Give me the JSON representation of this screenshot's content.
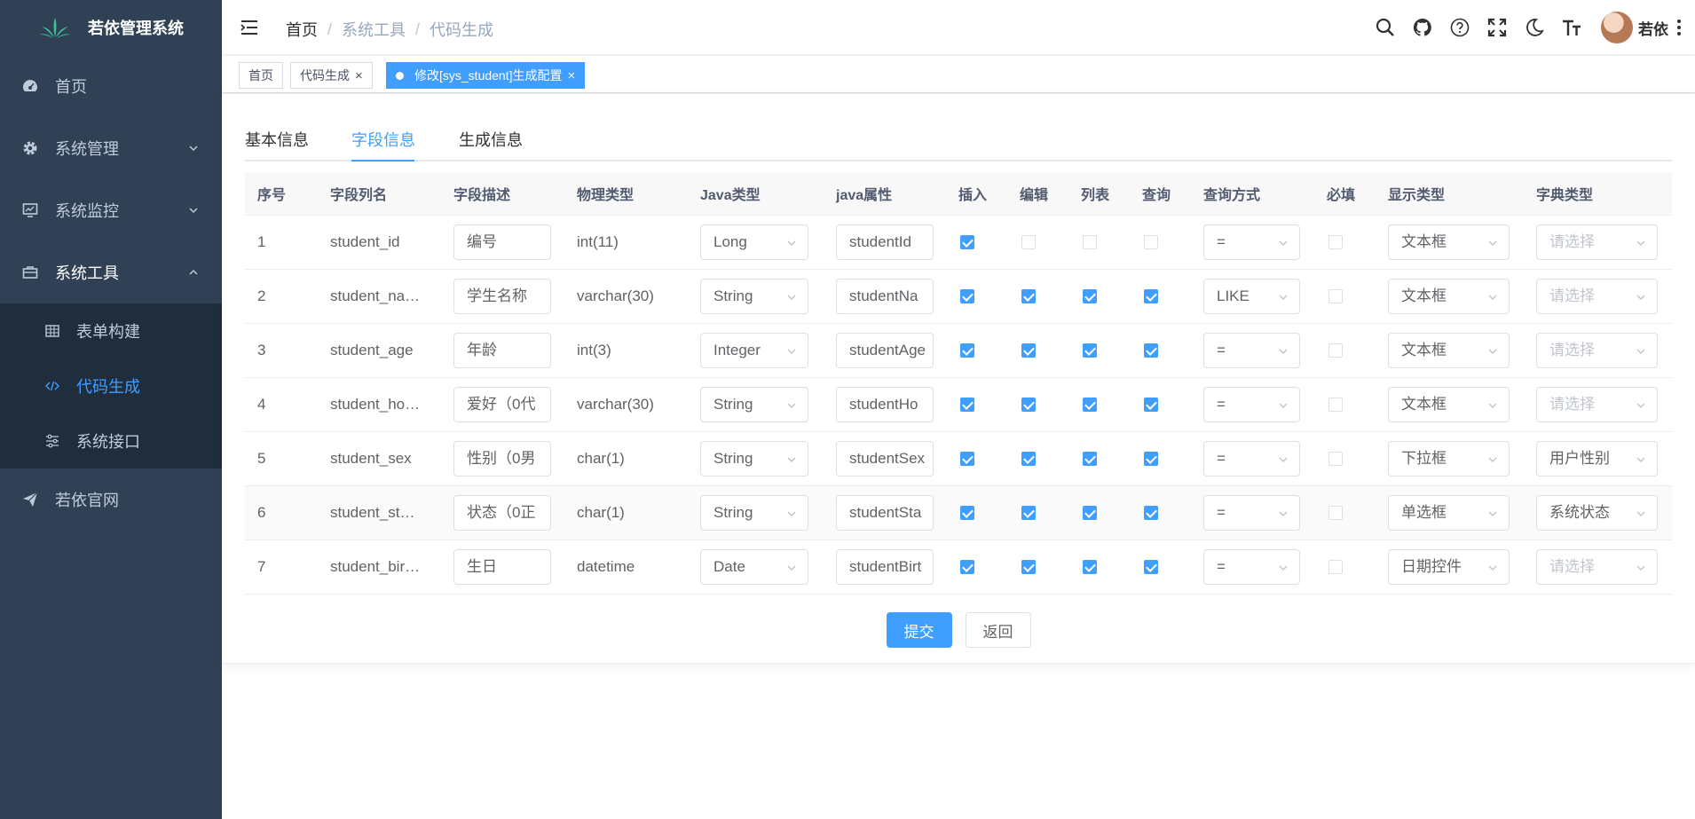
{
  "app": {
    "title": "若依管理系统"
  },
  "sidebar": {
    "items": [
      {
        "label": "首页",
        "icon": "dashboard-icon"
      },
      {
        "label": "系统管理",
        "icon": "gear-icon"
      },
      {
        "label": "系统监控",
        "icon": "monitor-icon"
      },
      {
        "label": "系统工具",
        "icon": "toolbox-icon"
      },
      {
        "label": "若依官网",
        "icon": "send-icon"
      }
    ],
    "tool_sub": [
      {
        "label": "表单构建",
        "icon": "table-icon"
      },
      {
        "label": "代码生成",
        "icon": "code-icon"
      },
      {
        "label": "系统接口",
        "icon": "sliders-icon"
      }
    ]
  },
  "navbar": {
    "breadcrumb": [
      "首页",
      "系统工具",
      "代码生成"
    ],
    "user": "若依"
  },
  "tags": [
    {
      "label": "首页"
    },
    {
      "label": "代码生成"
    },
    {
      "label": "修改[sys_student]生成配置"
    }
  ],
  "tabs": [
    "基本信息",
    "字段信息",
    "生成信息"
  ],
  "table": {
    "headers": [
      "序号",
      "字段列名",
      "字段描述",
      "物理类型",
      "Java类型",
      "java属性",
      "插入",
      "编辑",
      "列表",
      "查询",
      "查询方式",
      "必填",
      "显示类型",
      "字典类型"
    ],
    "rows": [
      {
        "no": "1",
        "column": "student_id",
        "desc": "编号",
        "phys": "int(11)",
        "jtype": "Long",
        "jprop": "studentId",
        "insert": true,
        "edit": false,
        "list": false,
        "query": false,
        "qmode": "=",
        "required": false,
        "display": "文本框",
        "dict": "请选择"
      },
      {
        "no": "2",
        "column": "student_na…",
        "desc": "学生名称",
        "phys": "varchar(30)",
        "jtype": "String",
        "jprop": "studentNa",
        "insert": true,
        "edit": true,
        "list": true,
        "query": true,
        "qmode": "LIKE",
        "required": false,
        "display": "文本框",
        "dict": "请选择"
      },
      {
        "no": "3",
        "column": "student_age",
        "desc": "年龄",
        "phys": "int(3)",
        "jtype": "Integer",
        "jprop": "studentAge",
        "insert": true,
        "edit": true,
        "list": true,
        "query": true,
        "qmode": "=",
        "required": false,
        "display": "文本框",
        "dict": "请选择"
      },
      {
        "no": "4",
        "column": "student_ho…",
        "desc": "爱好（0代",
        "phys": "varchar(30)",
        "jtype": "String",
        "jprop": "studentHo",
        "insert": true,
        "edit": true,
        "list": true,
        "query": true,
        "qmode": "=",
        "required": false,
        "display": "文本框",
        "dict": "请选择"
      },
      {
        "no": "5",
        "column": "student_sex",
        "desc": "性别（0男",
        "phys": "char(1)",
        "jtype": "String",
        "jprop": "studentSex",
        "insert": true,
        "edit": true,
        "list": true,
        "query": true,
        "qmode": "=",
        "required": false,
        "display": "下拉框",
        "dict": "用户性别"
      },
      {
        "no": "6",
        "column": "student_st…",
        "desc": "状态（0正",
        "phys": "char(1)",
        "jtype": "String",
        "jprop": "studentSta",
        "insert": true,
        "edit": true,
        "list": true,
        "query": true,
        "qmode": "=",
        "required": false,
        "display": "单选框",
        "dict": "系统状态"
      },
      {
        "no": "7",
        "column": "student_bir…",
        "desc": "生日",
        "phys": "datetime",
        "jtype": "Date",
        "jprop": "studentBirt",
        "insert": true,
        "edit": true,
        "list": true,
        "query": true,
        "qmode": "=",
        "required": false,
        "display": "日期控件",
        "dict": "请选择"
      }
    ]
  },
  "buttons": {
    "submit": "提交",
    "back": "返回"
  },
  "colors": {
    "primary": "#409eff",
    "sidebar_bg": "#304156",
    "submenu_bg": "#1f2d3d"
  }
}
